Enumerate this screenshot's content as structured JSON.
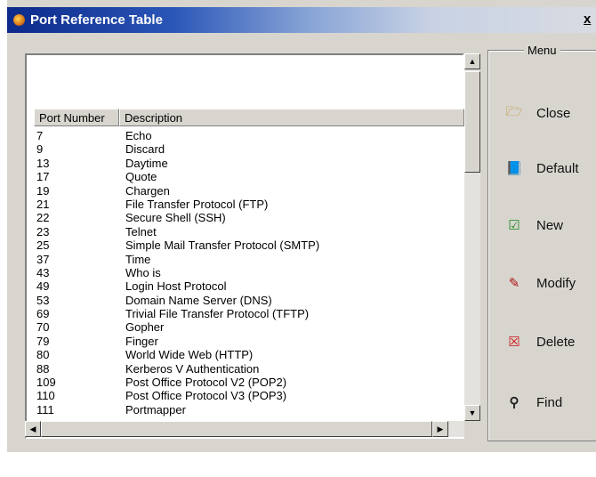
{
  "window": {
    "title": "Port Reference Table",
    "close_glyph": "x"
  },
  "table": {
    "columns": [
      "Port Number",
      "Description"
    ],
    "rows": [
      [
        "7",
        "Echo"
      ],
      [
        "9",
        "Discard"
      ],
      [
        "13",
        "Daytime"
      ],
      [
        "17",
        "Quote"
      ],
      [
        "19",
        "Chargen"
      ],
      [
        "21",
        "File Transfer Protocol (FTP)"
      ],
      [
        "22",
        "Secure Shell (SSH)"
      ],
      [
        "23",
        "Telnet"
      ],
      [
        "25",
        "Simple Mail Transfer Protocol (SMTP)"
      ],
      [
        "37",
        "Time"
      ],
      [
        "43",
        "Who is"
      ],
      [
        "49",
        "Login Host Protocol"
      ],
      [
        "53",
        "Domain Name Server (DNS)"
      ],
      [
        "69",
        "Trivial File Transfer Protocol (TFTP)"
      ],
      [
        "70",
        "Gopher"
      ],
      [
        "79",
        "Finger"
      ],
      [
        "80",
        "World Wide Web (HTTP)"
      ],
      [
        "88",
        "Kerberos V Authentication"
      ],
      [
        "109",
        "Post Office Protocol V2 (POP2)"
      ],
      [
        "110",
        "Post Office Protocol V3 (POP3)"
      ],
      [
        "111",
        "Portmapper"
      ]
    ]
  },
  "menu": {
    "caption": "Menu",
    "buttons": [
      {
        "label": "Close",
        "icon": "folder-open-icon",
        "glyph": "🗁"
      },
      {
        "label": "Default",
        "icon": "book-icon",
        "glyph": "📘"
      },
      {
        "label": "New",
        "icon": "checkmark-icon",
        "glyph": "☑"
      },
      {
        "label": "Modify",
        "icon": "edit-document-icon",
        "glyph": "✎"
      },
      {
        "label": "Delete",
        "icon": "delete-x-icon",
        "glyph": "☒"
      },
      {
        "label": "Find",
        "icon": "binoculars-icon",
        "glyph": "⚲"
      }
    ]
  },
  "scrollbar": {
    "up": "▲",
    "down": "▼",
    "left": "◀",
    "right": "▶"
  }
}
